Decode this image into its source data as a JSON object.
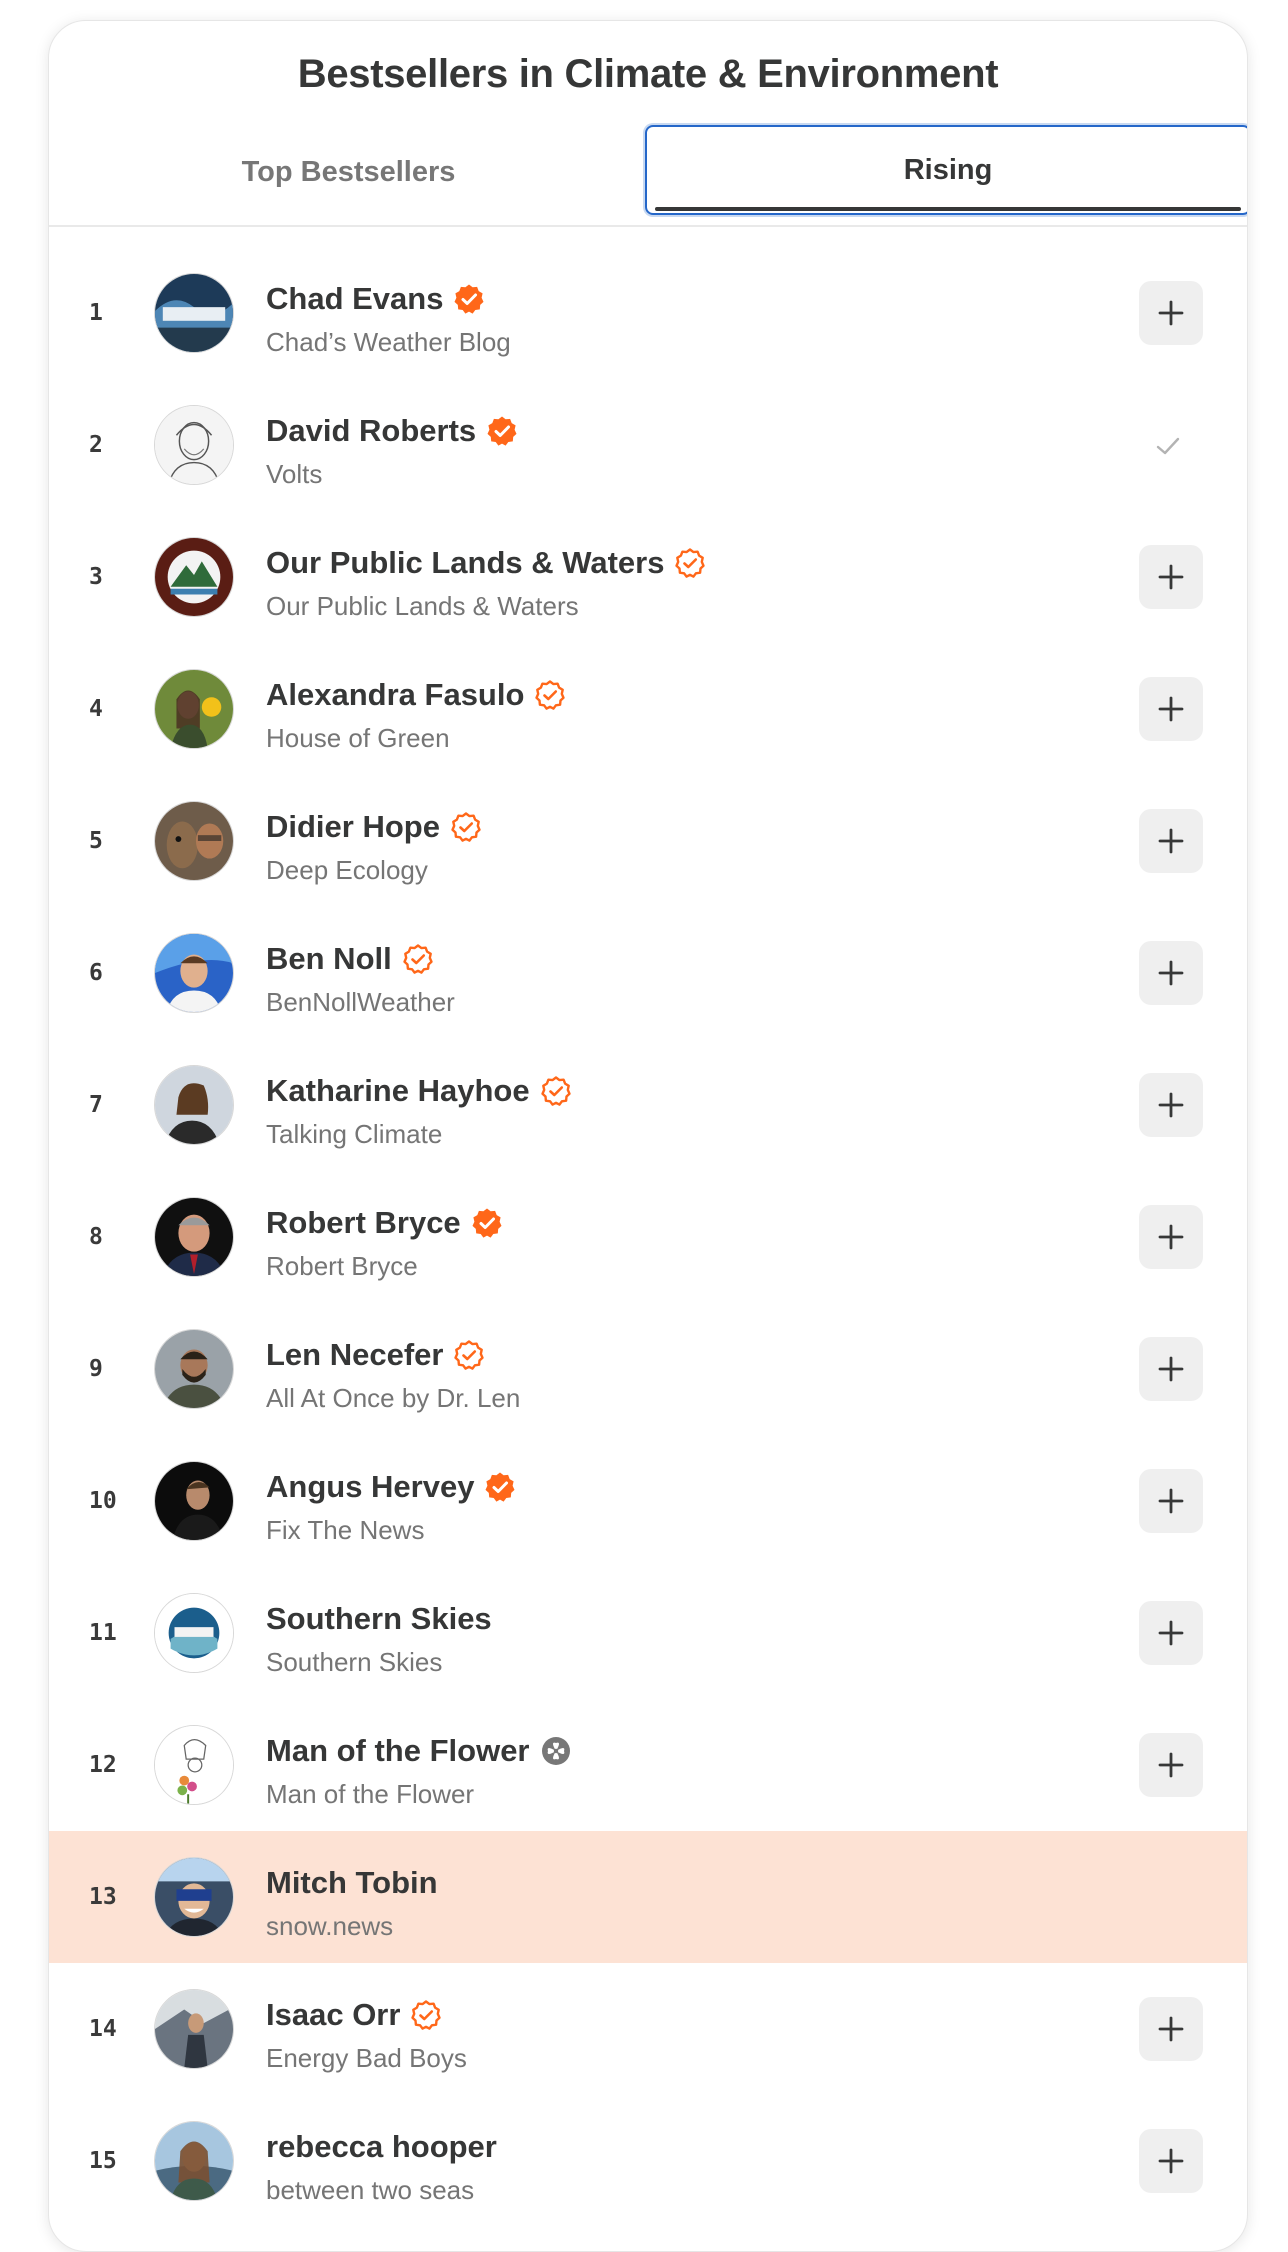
{
  "title": "Bestsellers in Climate & Environment",
  "tabs": [
    {
      "label": "Top Bestsellers"
    },
    {
      "label": "Rising"
    }
  ],
  "colors": {
    "accent": "#ff6719",
    "highlight_row": "#fde2d4",
    "focus_ring": "#2567c9"
  },
  "rows": [
    {
      "rank": "1",
      "name": "Chad Evans",
      "pub": "Chad’s Weather Blog",
      "badge": "solid",
      "action": "add"
    },
    {
      "rank": "2",
      "name": "David Roberts",
      "pub": "Volts",
      "badge": "solid",
      "action": "subscribed"
    },
    {
      "rank": "3",
      "name": "Our Public Lands & Waters",
      "pub": "Our Public Lands & Waters",
      "badge": "outline",
      "action": "add"
    },
    {
      "rank": "4",
      "name": "Alexandra Fasulo",
      "pub": "House of Green",
      "badge": "outline",
      "action": "add"
    },
    {
      "rank": "5",
      "name": "Didier Hope",
      "pub": "Deep Ecology",
      "badge": "outline",
      "action": "add"
    },
    {
      "rank": "6",
      "name": "Ben Noll",
      "pub": "BenNollWeather",
      "badge": "outline",
      "action": "add"
    },
    {
      "rank": "7",
      "name": "Katharine Hayhoe",
      "pub": "Talking Climate",
      "badge": "outline",
      "action": "add"
    },
    {
      "rank": "8",
      "name": "Robert Bryce",
      "pub": "Robert Bryce",
      "badge": "solid",
      "action": "add"
    },
    {
      "rank": "9",
      "name": "Len Necefer",
      "pub": "All At Once by Dr. Len",
      "badge": "outline",
      "action": "add"
    },
    {
      "rank": "10",
      "name": "Angus Hervey",
      "pub": "Fix The News",
      "badge": "solid",
      "action": "add"
    },
    {
      "rank": "11",
      "name": "Southern Skies",
      "pub": "Southern Skies",
      "badge": "none",
      "action": "add"
    },
    {
      "rank": "12",
      "name": "Man of the Flower",
      "pub": "Man of the Flower",
      "badge": "gray",
      "action": "add"
    },
    {
      "rank": "13",
      "name": "Mitch Tobin",
      "pub": "snow.news",
      "badge": "none",
      "action": "none"
    },
    {
      "rank": "14",
      "name": "Isaac Orr",
      "pub": "Energy Bad Boys",
      "badge": "outline",
      "action": "add"
    },
    {
      "rank": "15",
      "name": "rebecca hooper",
      "pub": "between two seas",
      "badge": "none",
      "action": "add"
    }
  ]
}
